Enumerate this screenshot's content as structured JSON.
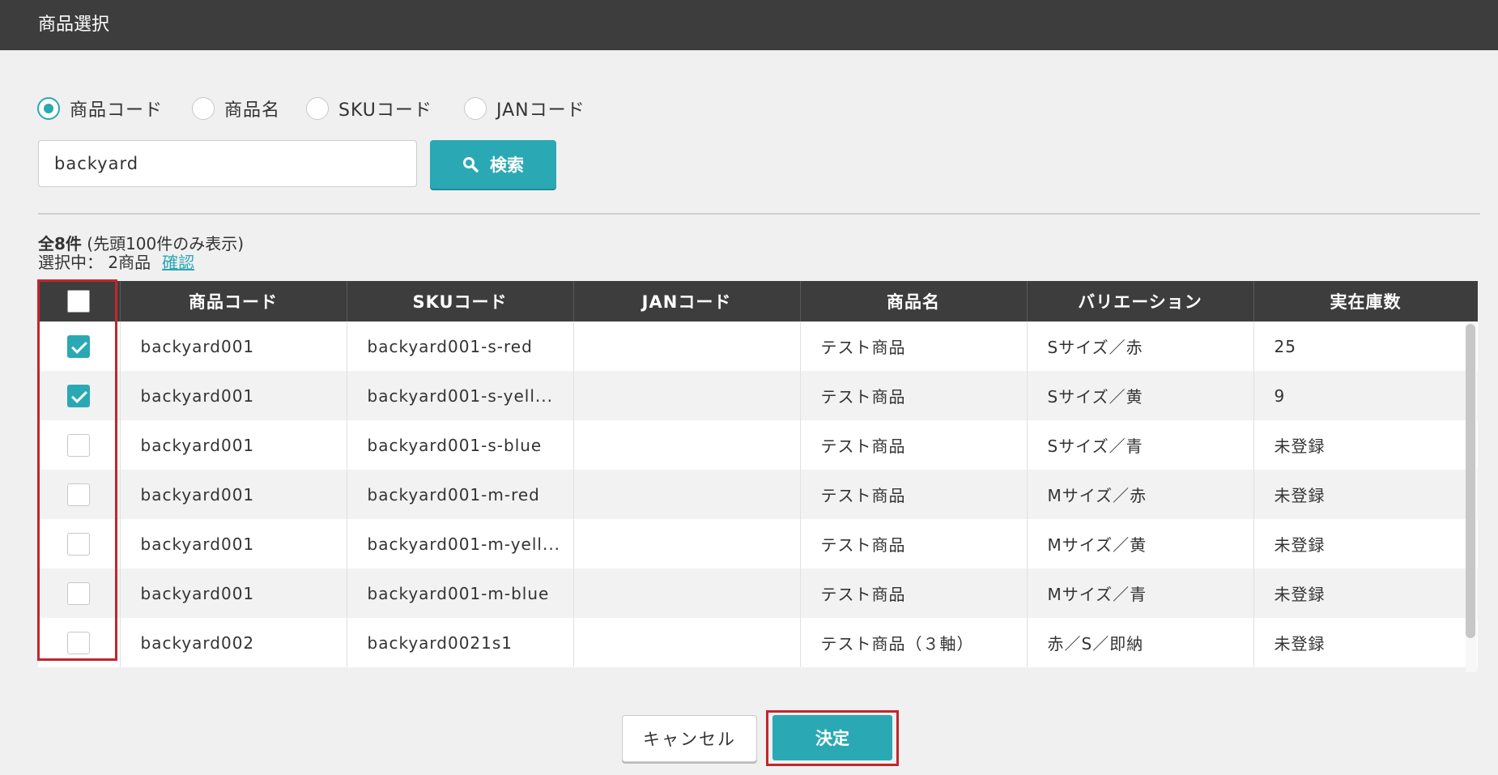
{
  "dialog": {
    "title": "商品選択"
  },
  "search_type": {
    "options": [
      {
        "label": "商品コード",
        "selected": true
      },
      {
        "label": "商品名",
        "selected": false
      },
      {
        "label": "SKUコード",
        "selected": false
      },
      {
        "label": "JANコード",
        "selected": false
      }
    ]
  },
  "search": {
    "value": "backyard",
    "button_label": "検索"
  },
  "summary": {
    "total": "全8件",
    "note": "(先頭100件のみ表示)",
    "selected_text": "選択中：  2商品",
    "confirm_link": "確認"
  },
  "table": {
    "headers": [
      "商品コード",
      "SKUコード",
      "JANコード",
      "商品名",
      "バリエーション",
      "実在庫数"
    ],
    "header_checkbox_checked": false,
    "rows": [
      {
        "checked": true,
        "code": "backyard001",
        "sku": "backyard001-s-red",
        "jan": "",
        "name": "テスト商品",
        "variation": "Sサイズ／赤",
        "stock": "25"
      },
      {
        "checked": true,
        "code": "backyard001",
        "sku": "backyard001-s-yell...",
        "jan": "",
        "name": "テスト商品",
        "variation": "Sサイズ／黄",
        "stock": "9"
      },
      {
        "checked": false,
        "code": "backyard001",
        "sku": "backyard001-s-blue",
        "jan": "",
        "name": "テスト商品",
        "variation": "Sサイズ／青",
        "stock": "未登録"
      },
      {
        "checked": false,
        "code": "backyard001",
        "sku": "backyard001-m-red",
        "jan": "",
        "name": "テスト商品",
        "variation": "Mサイズ／赤",
        "stock": "未登録"
      },
      {
        "checked": false,
        "code": "backyard001",
        "sku": "backyard001-m-yell...",
        "jan": "",
        "name": "テスト商品",
        "variation": "Mサイズ／黄",
        "stock": "未登録"
      },
      {
        "checked": false,
        "code": "backyard001",
        "sku": "backyard001-m-blue",
        "jan": "",
        "name": "テスト商品",
        "variation": "Mサイズ／青",
        "stock": "未登録"
      },
      {
        "checked": false,
        "code": "backyard002",
        "sku": "backyard0021s1",
        "jan": "",
        "name": "テスト商品（３軸）",
        "variation": "赤／S／即納",
        "stock": "未登録"
      }
    ]
  },
  "footer": {
    "cancel_label": "キャンセル",
    "ok_label": "決定"
  },
  "colors": {
    "accent": "#2aa9b4",
    "header_bg": "#3d3d3d",
    "highlight": "#c1272d",
    "background": "#f0f0f0"
  }
}
